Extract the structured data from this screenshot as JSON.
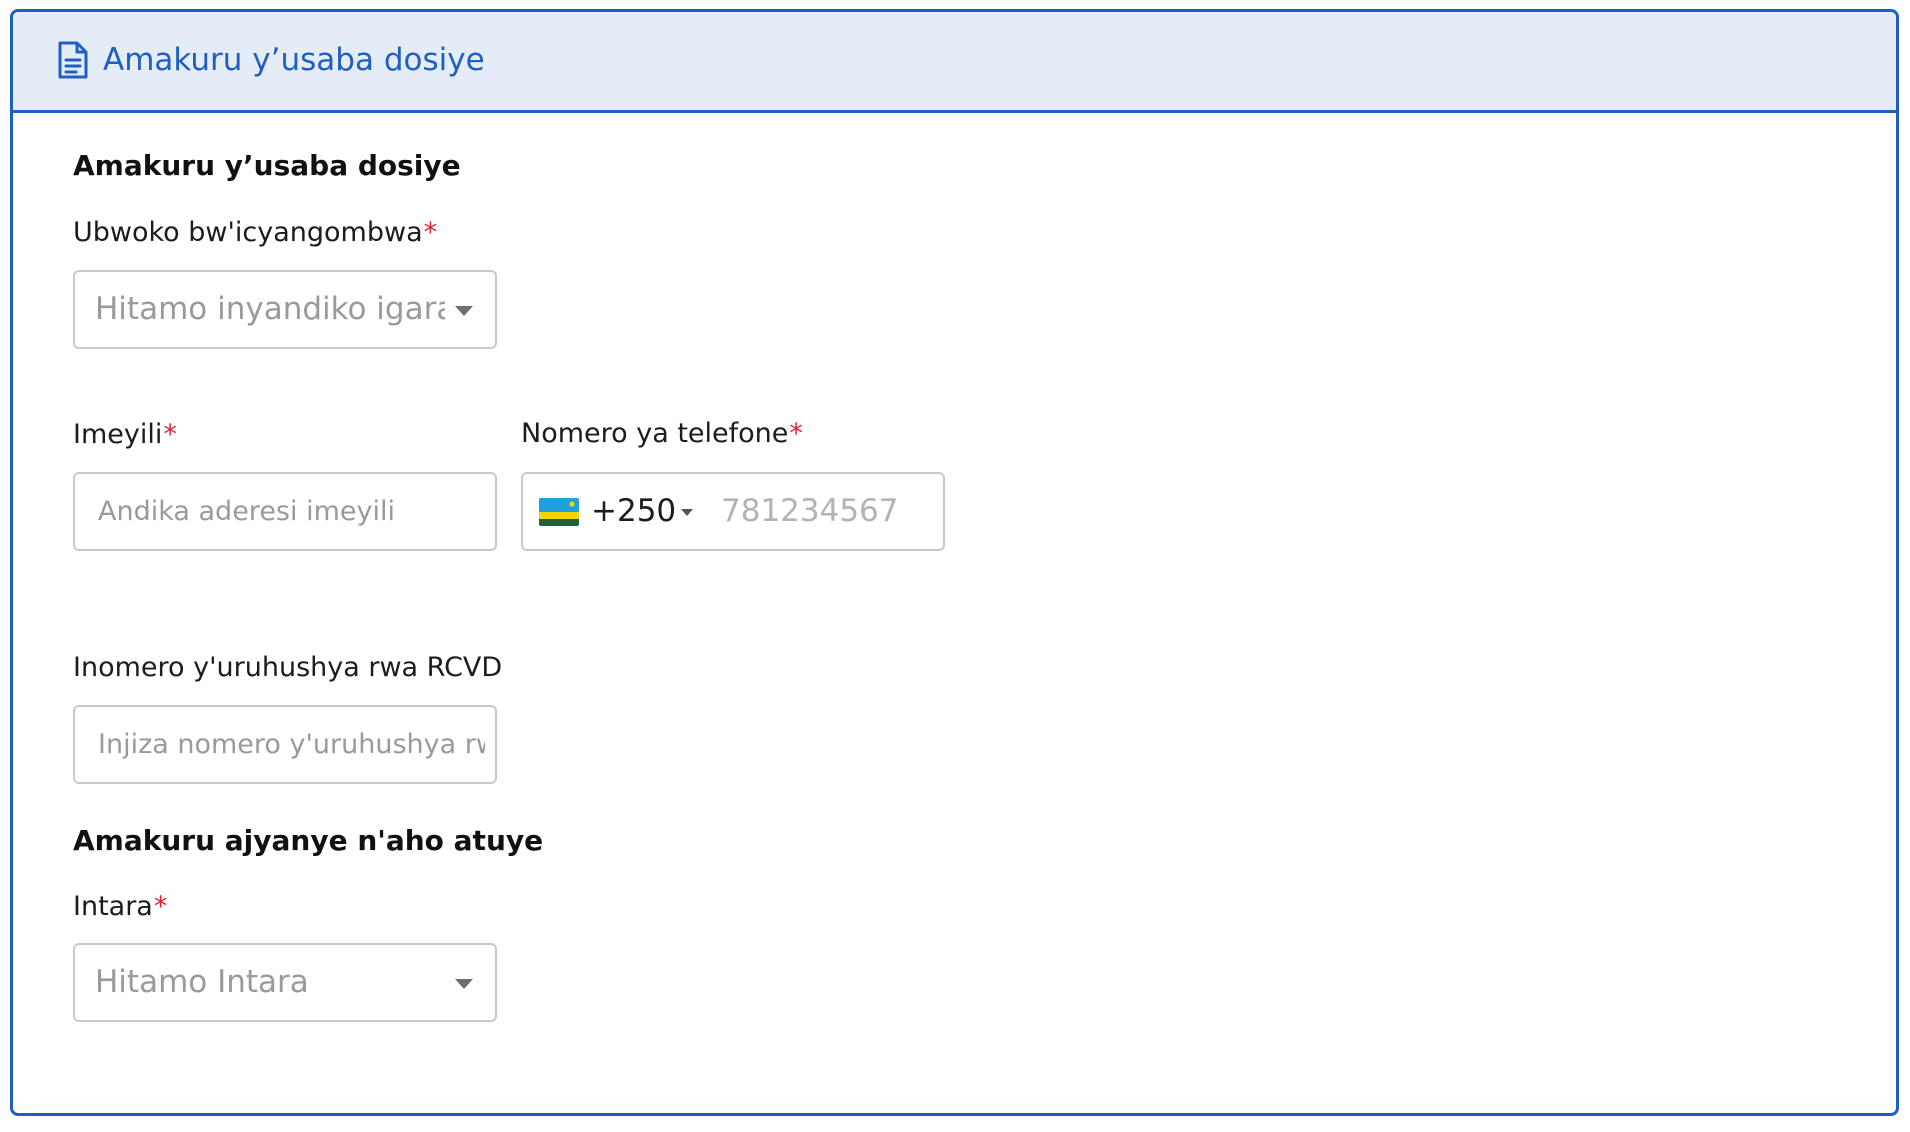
{
  "panel": {
    "header_title": "Amakuru y’usaba dosiye",
    "header_icon": "document-icon",
    "accent_color": "#1f5fbf",
    "header_bg": "#e4edf7"
  },
  "applicant_section": {
    "title": "Amakuru y’usaba dosiye",
    "document_type": {
      "label": "Ubwoko bw'icyangombwa",
      "required_mark": "*",
      "placeholder": "Hitamo inyandiko igaragaza umwirondoro",
      "value": ""
    },
    "email": {
      "label": "Imeyili",
      "required_mark": "*",
      "placeholder": "Andika aderesi imeyili",
      "value": ""
    },
    "phone": {
      "label": "Nomero ya telefone",
      "required_mark": "*",
      "country_flag": "rwanda-flag-icon",
      "dial_code": "+250",
      "placeholder": "781234567",
      "value": ""
    },
    "rcvd_number": {
      "label": "Inomero y'uruhushya rwa RCVD",
      "placeholder": "Injiza nomero y'uruhushya rwa RCVD",
      "value": ""
    }
  },
  "residence_section": {
    "title": "Amakuru ajyanye n'aho atuye",
    "province": {
      "label": "Intara",
      "required_mark": "*",
      "placeholder": "Hitamo Intara",
      "value": ""
    }
  }
}
